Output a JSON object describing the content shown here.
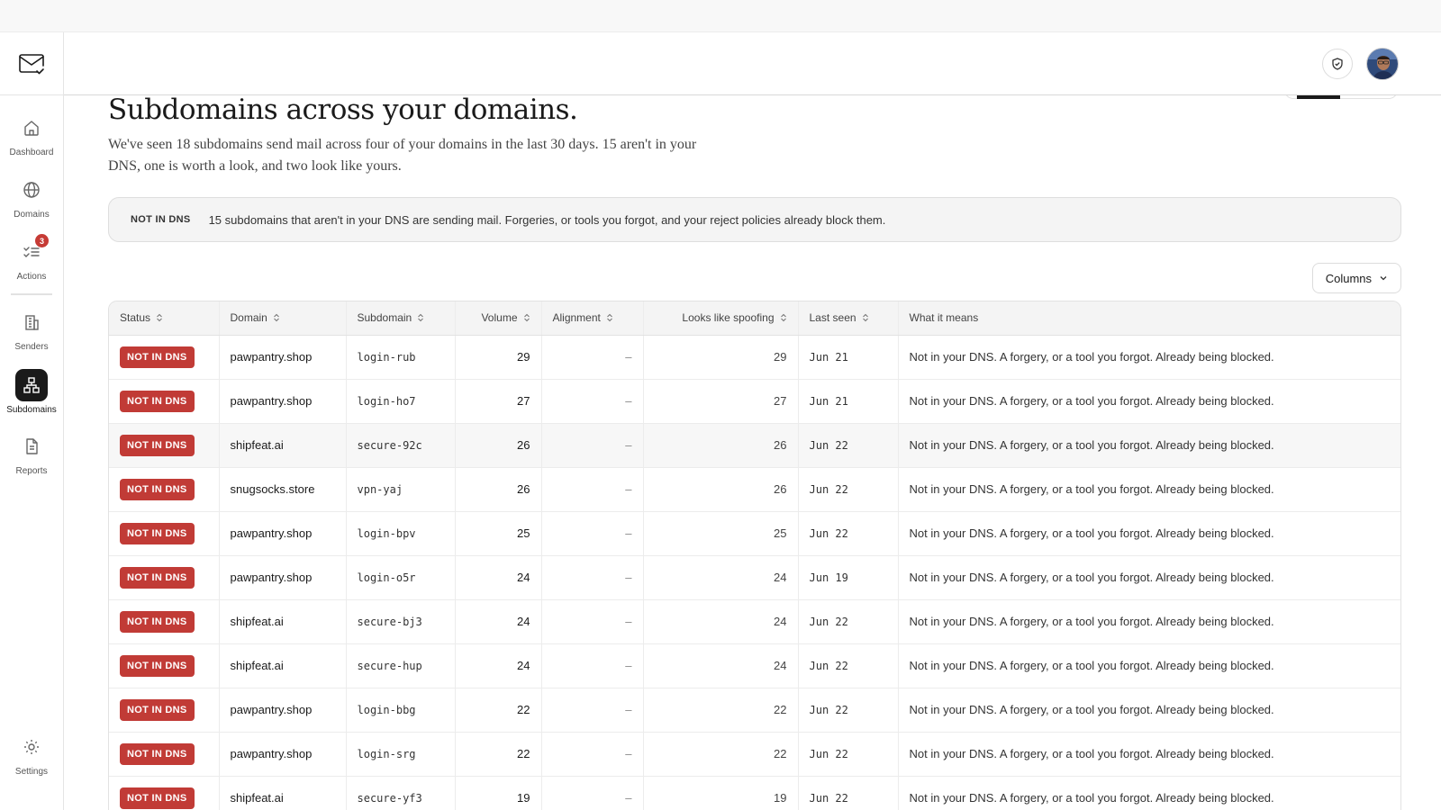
{
  "sidebar": {
    "items": [
      {
        "label": "Dashboard",
        "icon": "home-icon"
      },
      {
        "label": "Domains",
        "icon": "globe-icon"
      },
      {
        "label": "Actions",
        "icon": "checklist-icon",
        "badge": "3"
      },
      {
        "label": "Senders",
        "icon": "building-icon"
      },
      {
        "label": "Subdomains",
        "icon": "sitemap-icon",
        "active": true
      },
      {
        "label": "Reports",
        "icon": "document-icon"
      }
    ],
    "settings_label": "Settings"
  },
  "page": {
    "title": "Subdomains across your domains.",
    "subtitle": "We've seen 18 subdomains send mail across four of your domains in the last 30 days. 15 aren't in your DNS, one is worth a look, and two look like yours."
  },
  "banner": {
    "tag": "NOT IN DNS",
    "text": "15 subdomains that aren't in your DNS are sending mail. Forgeries, or tools you forgot, and your reject policies already block them."
  },
  "columns_button": "Columns",
  "table": {
    "headers": [
      "Status",
      "Domain",
      "Subdomain",
      "Volume",
      "Alignment",
      "Looks like spoofing",
      "Last seen",
      "What it means"
    ],
    "rows": [
      {
        "status": "NOT IN DNS",
        "domain": "pawpantry.shop",
        "subdomain": "login-rub",
        "volume": "29",
        "alignment": "–",
        "spoofing": "29",
        "last_seen": "Jun 21",
        "meaning": "Not in your DNS. A forgery, or a tool you forgot. Already being blocked."
      },
      {
        "status": "NOT IN DNS",
        "domain": "pawpantry.shop",
        "subdomain": "login-ho7",
        "volume": "27",
        "alignment": "–",
        "spoofing": "27",
        "last_seen": "Jun 21",
        "meaning": "Not in your DNS. A forgery, or a tool you forgot. Already being blocked."
      },
      {
        "status": "NOT IN DNS",
        "domain": "shipfeat.ai",
        "subdomain": "secure-92c",
        "volume": "26",
        "alignment": "–",
        "spoofing": "26",
        "last_seen": "Jun 22",
        "meaning": "Not in your DNS. A forgery, or a tool you forgot. Already being blocked."
      },
      {
        "status": "NOT IN DNS",
        "domain": "snugsocks.store",
        "subdomain": "vpn-yaj",
        "volume": "26",
        "alignment": "–",
        "spoofing": "26",
        "last_seen": "Jun 22",
        "meaning": "Not in your DNS. A forgery, or a tool you forgot. Already being blocked."
      },
      {
        "status": "NOT IN DNS",
        "domain": "pawpantry.shop",
        "subdomain": "login-bpv",
        "volume": "25",
        "alignment": "–",
        "spoofing": "25",
        "last_seen": "Jun 22",
        "meaning": "Not in your DNS. A forgery, or a tool you forgot. Already being blocked."
      },
      {
        "status": "NOT IN DNS",
        "domain": "pawpantry.shop",
        "subdomain": "login-o5r",
        "volume": "24",
        "alignment": "–",
        "spoofing": "24",
        "last_seen": "Jun 19",
        "meaning": "Not in your DNS. A forgery, or a tool you forgot. Already being blocked."
      },
      {
        "status": "NOT IN DNS",
        "domain": "shipfeat.ai",
        "subdomain": "secure-bj3",
        "volume": "24",
        "alignment": "–",
        "spoofing": "24",
        "last_seen": "Jun 22",
        "meaning": "Not in your DNS. A forgery, or a tool you forgot. Already being blocked."
      },
      {
        "status": "NOT IN DNS",
        "domain": "shipfeat.ai",
        "subdomain": "secure-hup",
        "volume": "24",
        "alignment": "–",
        "spoofing": "24",
        "last_seen": "Jun 22",
        "meaning": "Not in your DNS. A forgery, or a tool you forgot. Already being blocked."
      },
      {
        "status": "NOT IN DNS",
        "domain": "pawpantry.shop",
        "subdomain": "login-bbg",
        "volume": "22",
        "alignment": "–",
        "spoofing": "22",
        "last_seen": "Jun 22",
        "meaning": "Not in your DNS. A forgery, or a tool you forgot. Already being blocked."
      },
      {
        "status": "NOT IN DNS",
        "domain": "pawpantry.shop",
        "subdomain": "login-srg",
        "volume": "22",
        "alignment": "–",
        "spoofing": "22",
        "last_seen": "Jun 22",
        "meaning": "Not in your DNS. A forgery, or a tool you forgot. Already being blocked."
      },
      {
        "status": "NOT IN DNS",
        "domain": "shipfeat.ai",
        "subdomain": "secure-yf3",
        "volume": "19",
        "alignment": "–",
        "spoofing": "19",
        "last_seen": "Jun 22",
        "meaning": "Not in your DNS. A forgery, or a tool you forgot. Already being blocked."
      }
    ]
  },
  "colors": {
    "status_red": "#c13b36",
    "active_nav": "#1a1a1a",
    "badge": "#c63b35"
  }
}
